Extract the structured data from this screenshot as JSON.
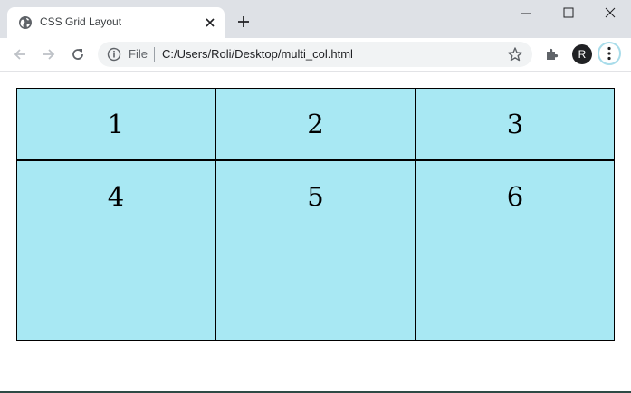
{
  "tab": {
    "title": "CSS Grid Layout",
    "favicon": "globe-icon",
    "close": "close-icon"
  },
  "window_controls": [
    "minimize-icon",
    "maximize-icon",
    "close-icon"
  ],
  "toolbar": {
    "back": "back-arrow-icon",
    "forward": "forward-arrow-icon",
    "reload": "reload-icon",
    "omnibox": {
      "info_icon": "info-icon",
      "scheme_label": "File",
      "url": "C:/Users/Roli/Desktop/multi_col.html",
      "star": "star-icon"
    },
    "extensions": "puzzle-icon",
    "avatar_initial": "R",
    "menu": "kebab-menu-icon"
  },
  "grid": {
    "cell_color": "#a8e8f3",
    "cells": [
      "1",
      "2",
      "3",
      "4",
      "5",
      "6"
    ]
  }
}
